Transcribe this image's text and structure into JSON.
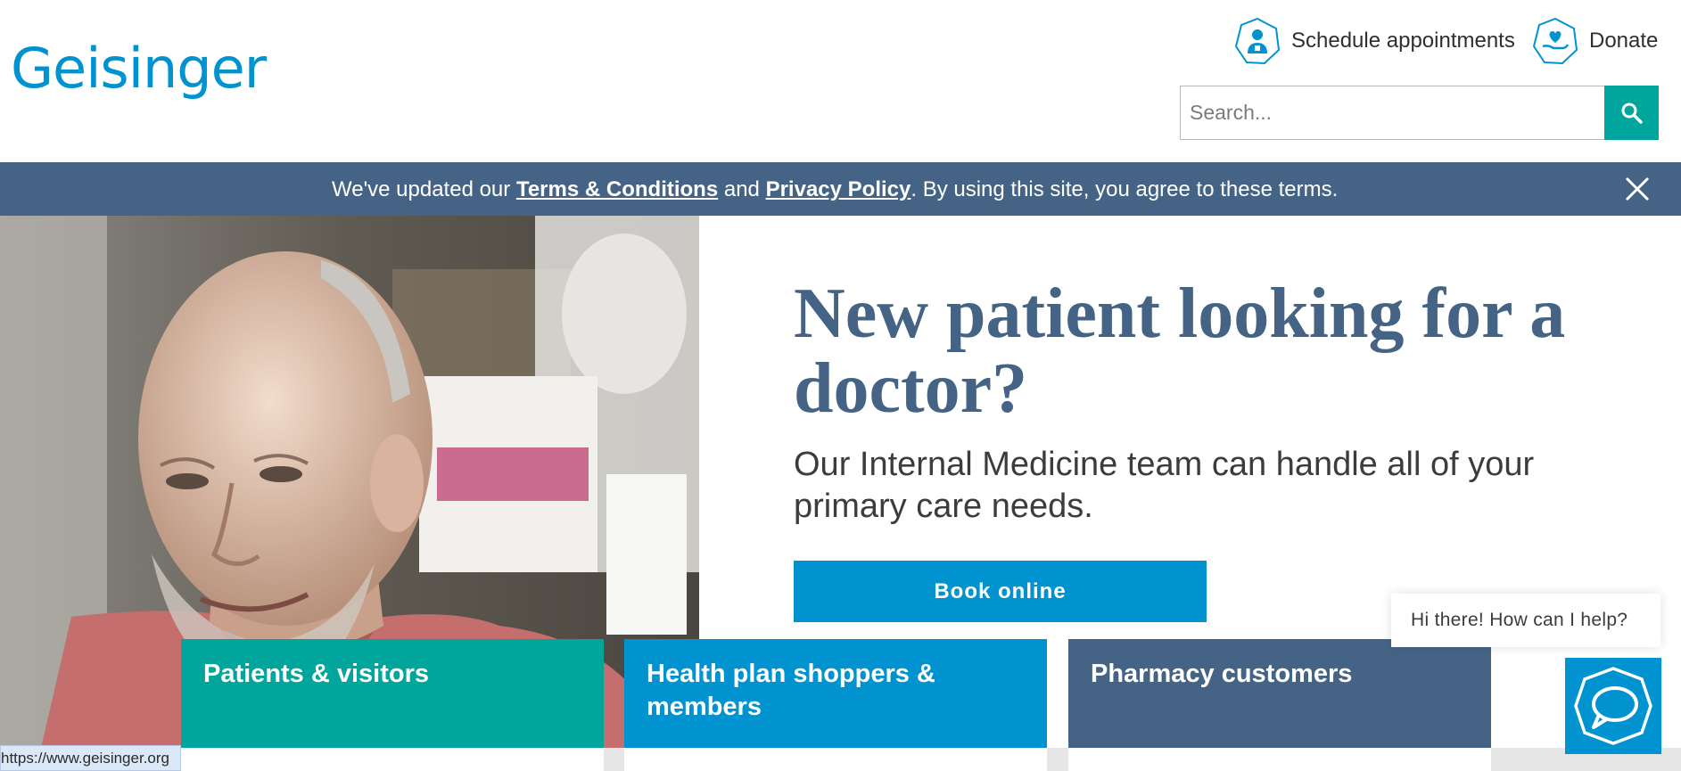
{
  "header": {
    "logo": "Geisinger",
    "schedule_label": "Schedule appointments",
    "donate_label": "Donate",
    "search_placeholder": "Search..."
  },
  "notice": {
    "prefix": "We've updated our ",
    "terms_link": "Terms & Conditions",
    "middle": " and ",
    "privacy_link": "Privacy Policy",
    "suffix": ". By using this site, you agree to these terms."
  },
  "hero": {
    "title": "New patient looking for a doctor?",
    "subtitle": "Our Internal Medicine team can handle all of your primary care needs.",
    "button": "Book online"
  },
  "cards": [
    {
      "label": "Patients & visitors"
    },
    {
      "label": "Health plan shoppers & members"
    },
    {
      "label": "Pharmacy customers"
    }
  ],
  "chat": {
    "greeting": "Hi there! How can I help?"
  },
  "status_bar": {
    "url": "https://www.geisinger.org"
  },
  "colors": {
    "brand_blue": "#0093d0",
    "teal": "#00a59b",
    "slate": "#456485"
  },
  "icons": {
    "schedule": "doctor-hexagon-icon",
    "donate": "hand-heart-hexagon-icon",
    "search": "search-icon",
    "close": "close-icon",
    "chat": "chat-bubble-icon"
  }
}
